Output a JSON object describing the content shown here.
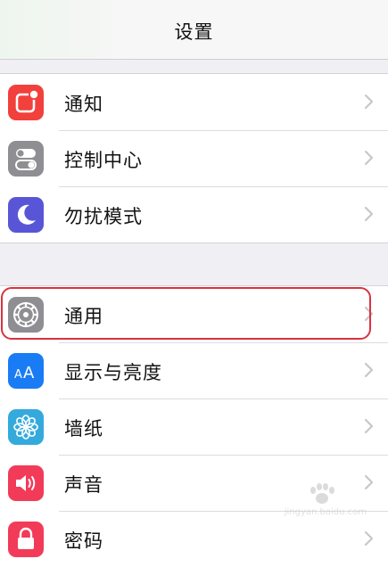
{
  "navbar": {
    "title": "设置"
  },
  "groups": [
    {
      "items": [
        {
          "label": "通知",
          "icon": "notifications-icon",
          "color": "#f2403d"
        },
        {
          "label": "控制中心",
          "icon": "control-center-icon",
          "color": "#8e8e93"
        },
        {
          "label": "勿扰模式",
          "icon": "do-not-disturb-icon",
          "color": "#5856d6"
        }
      ]
    },
    {
      "items": [
        {
          "label": "通用",
          "icon": "gear-icon",
          "color": "#8e8e93",
          "highlighted": true
        },
        {
          "label": "显示与亮度",
          "icon": "display-brightness-icon",
          "color": "#1a7cf5"
        },
        {
          "label": "墙纸",
          "icon": "wallpaper-icon",
          "color": "#34aadc"
        },
        {
          "label": "声音",
          "icon": "sounds-icon",
          "color": "#f23b58"
        },
        {
          "label": "密码",
          "icon": "passcode-icon",
          "color": "#f23b58"
        }
      ]
    }
  ],
  "highlight_color": "#d9333f",
  "watermark": {
    "text": "jingyan.baidu.com"
  }
}
